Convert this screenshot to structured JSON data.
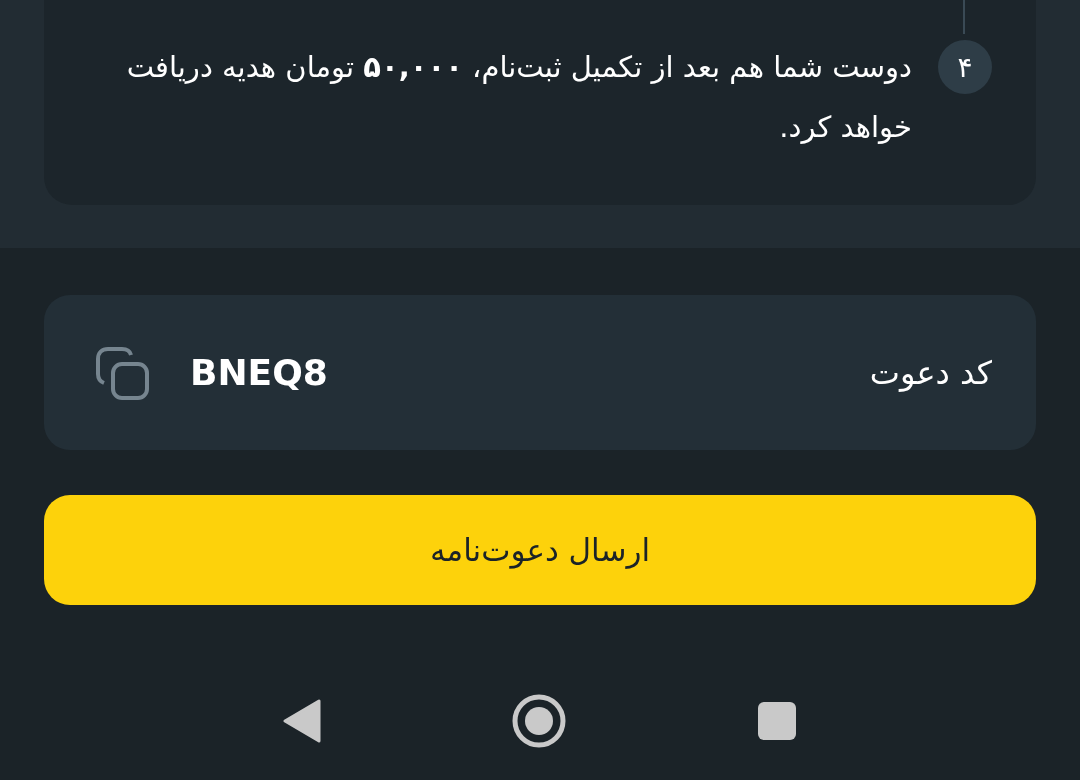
{
  "step": {
    "number": "۴",
    "text": "دوست شما هم بعد از تکمیل ثبت‌نام، **۵۰,۰۰۰** تومان هدیه دریافت خواهد کرد."
  },
  "invite": {
    "label": "کد دعوت",
    "code": "BNEQ8"
  },
  "send_button": {
    "label": "ارسال دعوت‌نامه"
  }
}
